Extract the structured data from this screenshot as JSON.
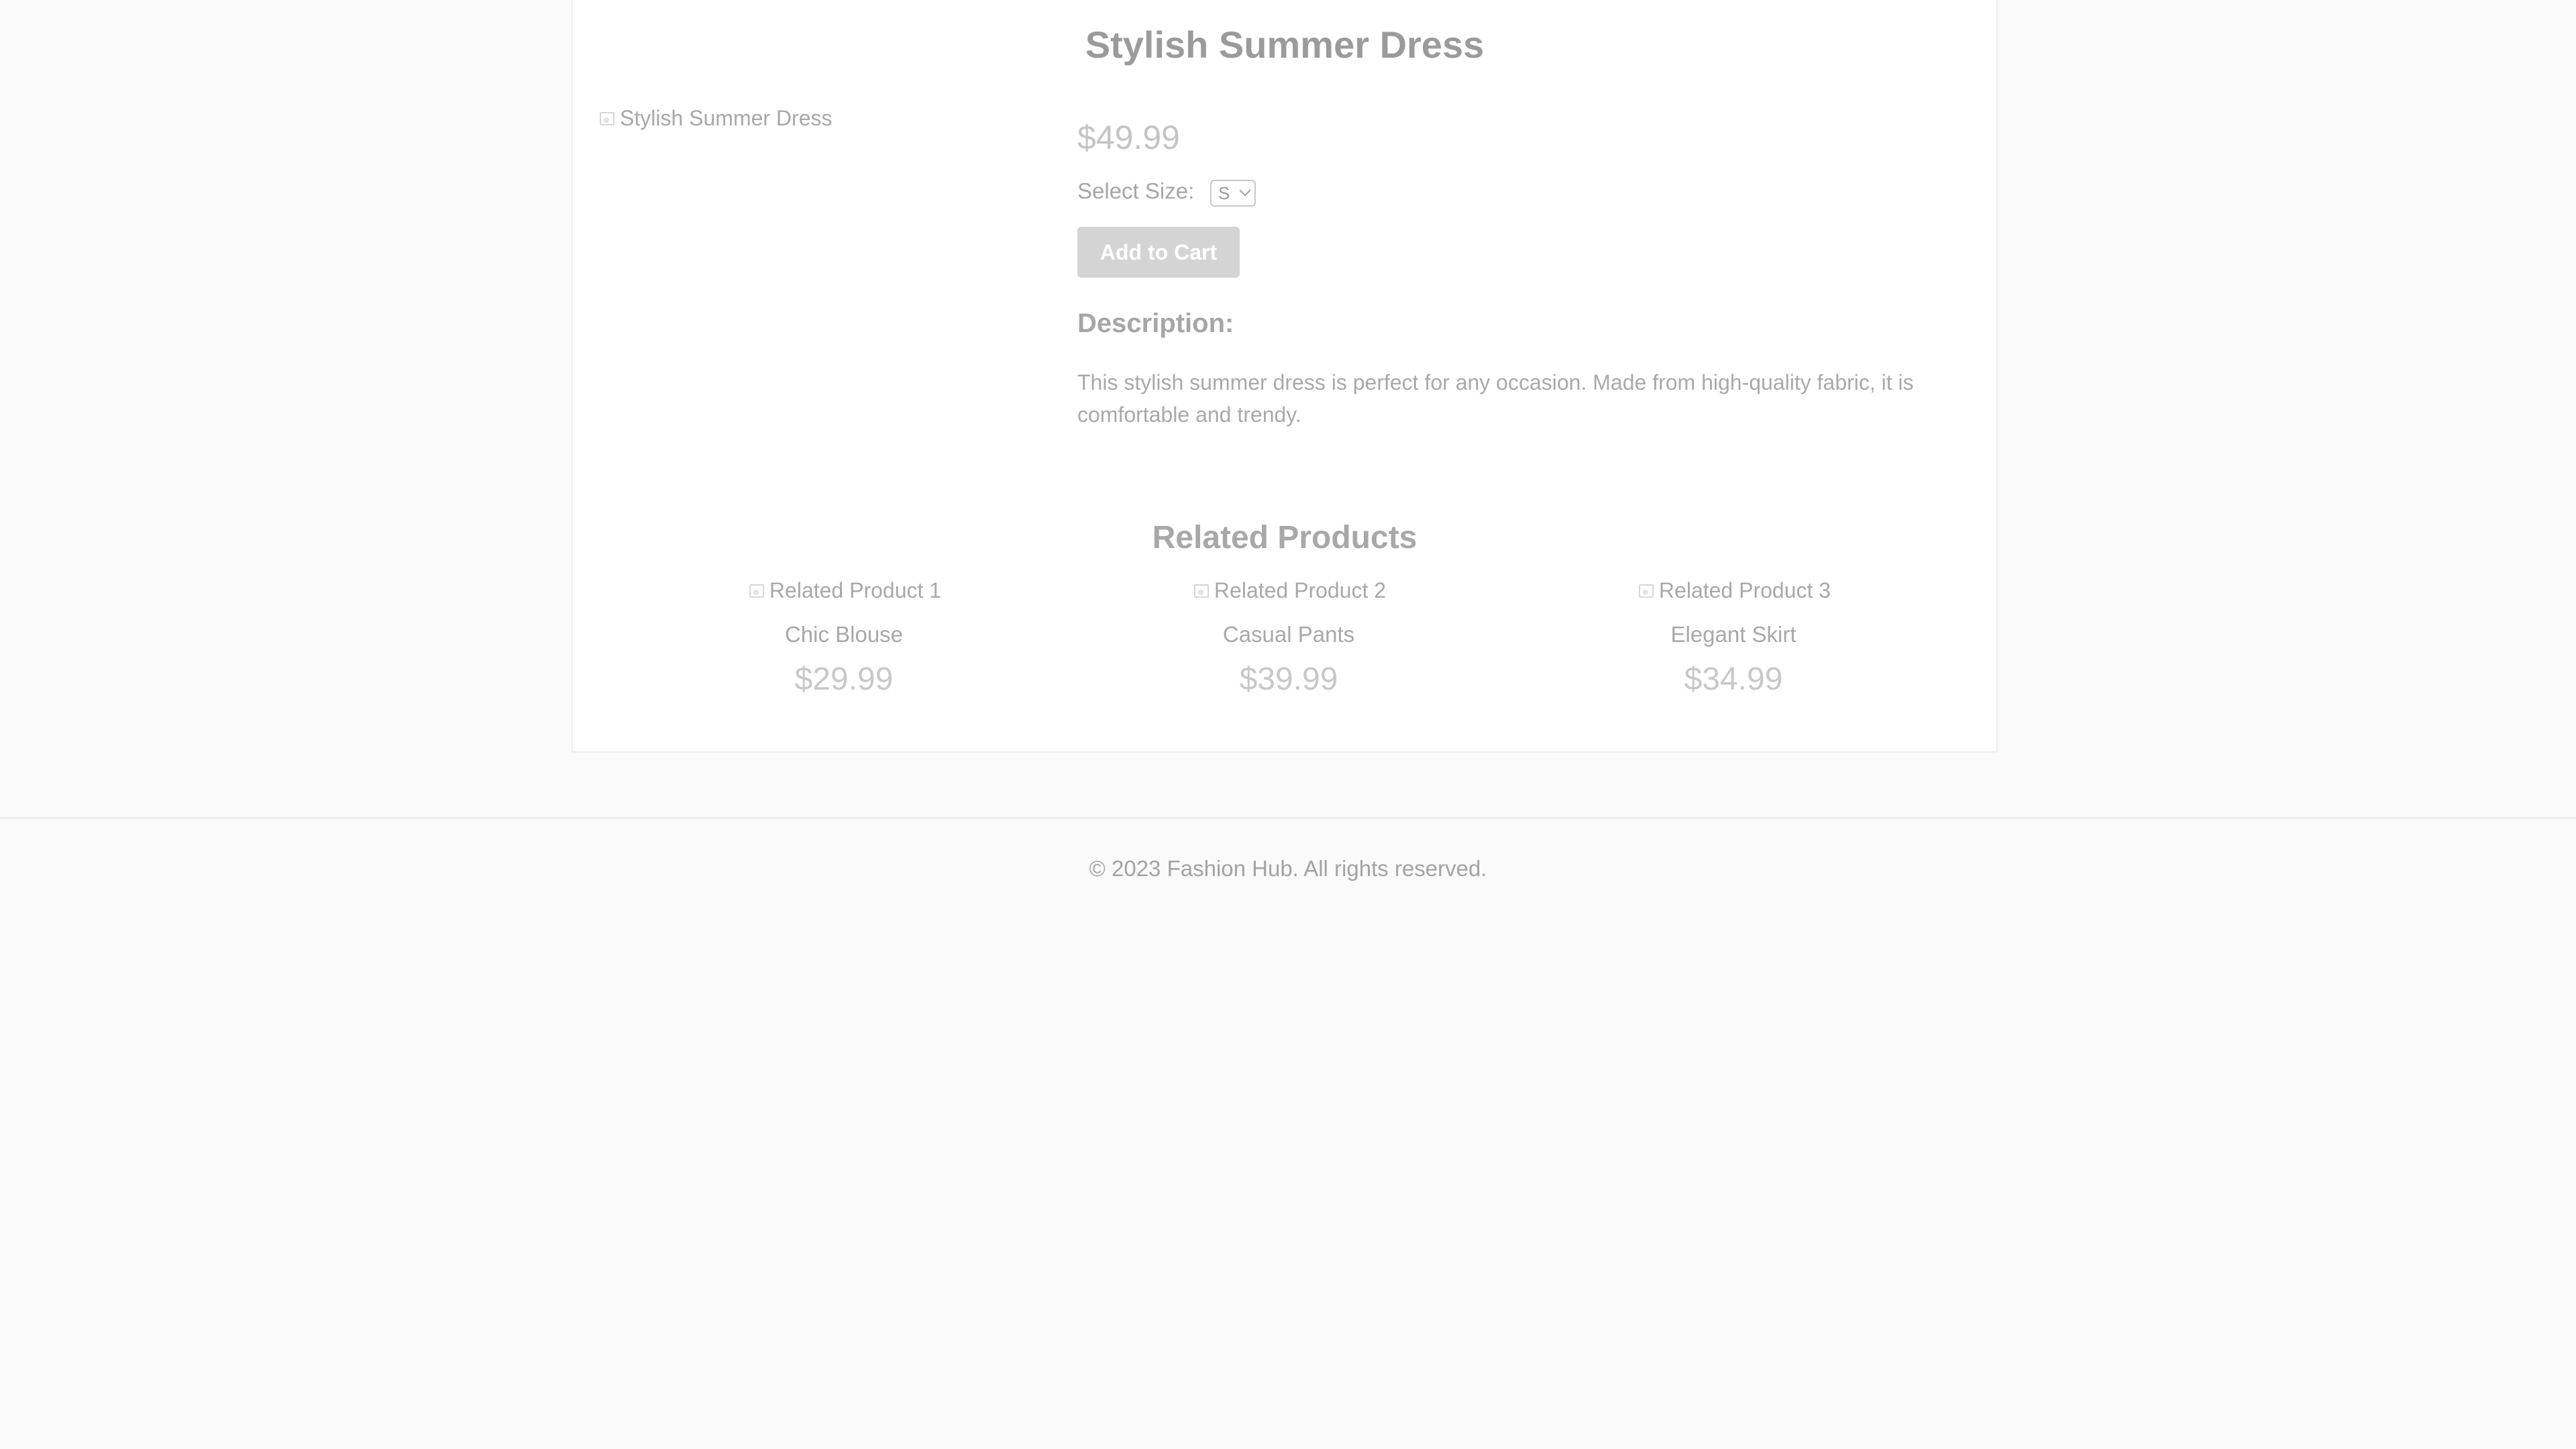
{
  "product": {
    "title": "Stylish Summer Dress",
    "image_alt": "Stylish Summer Dress",
    "price": "$49.99",
    "size_label": "Select Size:",
    "size_selected": "S",
    "add_to_cart_label": "Add to Cart",
    "description_heading": "Description:",
    "description_text": "This stylish summer dress is perfect for any occasion. Made from high-quality fabric, it is comfortable and trendy."
  },
  "related": {
    "title": "Related Products",
    "items": [
      {
        "image_alt": "Related Product 1",
        "name": "Chic Blouse",
        "price": "$29.99"
      },
      {
        "image_alt": "Related Product 2",
        "name": "Casual Pants",
        "price": "$39.99"
      },
      {
        "image_alt": "Related Product 3",
        "name": "Elegant Skirt",
        "price": "$34.99"
      }
    ]
  },
  "footer": {
    "copyright": "© 2023 Fashion Hub. All rights reserved."
  },
  "icons": {
    "broken_image": "broken-image-icon",
    "dropdown": "chevron-down-icon"
  },
  "colors": {
    "page_bg": "#fafafa",
    "card_bg": "#ffffff",
    "button_bg": "#d4d4d4"
  }
}
